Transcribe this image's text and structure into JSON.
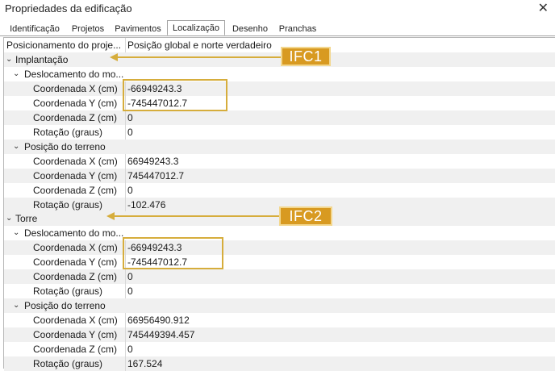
{
  "window": {
    "title": "Propriedades da edificação",
    "close_glyph": "✕"
  },
  "tabs": [
    {
      "label": "Identificação"
    },
    {
      "label": "Projetos"
    },
    {
      "label": "Pavimentos"
    },
    {
      "label": "Localização",
      "active": true
    },
    {
      "label": "Desenho"
    },
    {
      "label": "Pranchas"
    }
  ],
  "grid": {
    "positioning": {
      "name": "Posicionamento do proje...",
      "value": "Posição global e norte verdadeiro"
    },
    "implantacao": {
      "label": "Implantação",
      "deslocamento": {
        "label": "Deslocamento do mo...",
        "x": {
          "name": "Coordenada X (cm)",
          "value": "-66949243.3"
        },
        "y": {
          "name": "Coordenada Y (cm)",
          "value": "-745447012.7"
        },
        "z": {
          "name": "Coordenada Z (cm)",
          "value": "0"
        },
        "r": {
          "name": "Rotação (graus)",
          "value": "0"
        }
      },
      "terreno": {
        "label": "Posição do terreno",
        "x": {
          "name": "Coordenada X (cm)",
          "value": "66949243.3"
        },
        "y": {
          "name": "Coordenada Y (cm)",
          "value": "745447012.7"
        },
        "z": {
          "name": "Coordenada Z (cm)",
          "value": "0"
        },
        "r": {
          "name": "Rotação (graus)",
          "value": "-102.476"
        }
      }
    },
    "torre": {
      "label": "Torre",
      "deslocamento": {
        "label": "Deslocamento do mo...",
        "x": {
          "name": "Coordenada X (cm)",
          "value": "-66949243.3"
        },
        "y": {
          "name": "Coordenada Y (cm)",
          "value": "-745447012.7"
        },
        "z": {
          "name": "Coordenada Z (cm)",
          "value": "0"
        },
        "r": {
          "name": "Rotação (graus)",
          "value": "0"
        }
      },
      "terreno": {
        "label": "Posição do terreno",
        "x": {
          "name": "Coordenada X (cm)",
          "value": "66956490.912"
        },
        "y": {
          "name": "Coordenada Y (cm)",
          "value": "745449394.457"
        },
        "z": {
          "name": "Coordenada Z (cm)",
          "value": "0"
        },
        "r": {
          "name": "Rotação (graus)",
          "value": "167.524"
        }
      }
    }
  },
  "annotations": {
    "ifc1": "IFC1",
    "ifc2": "IFC2"
  },
  "icons": {
    "expanded": "chevron-down-icon",
    "close": "close-icon"
  },
  "colors": {
    "accent": "#d6ad3c",
    "callout_bg": "#d89a21",
    "alt_row": "#f0f0f0"
  }
}
